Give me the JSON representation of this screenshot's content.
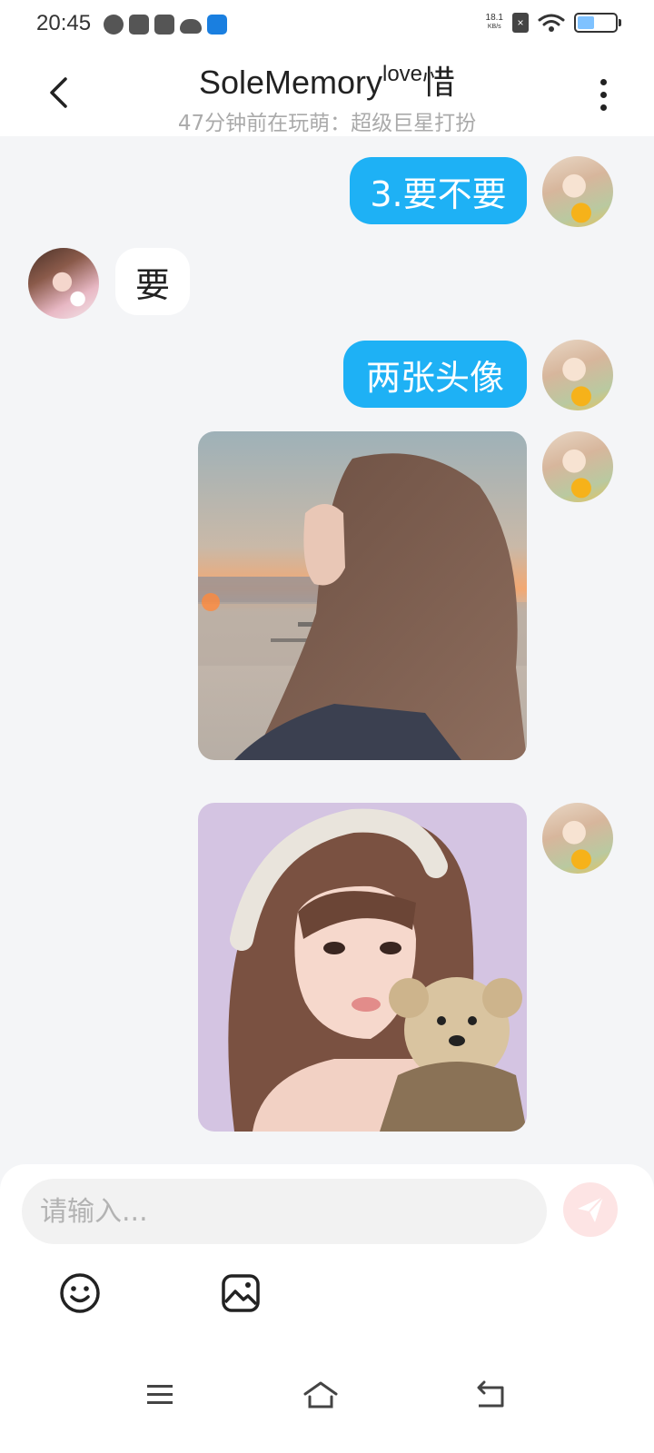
{
  "status_bar": {
    "time": "20:45",
    "speed_value": "18.1",
    "speed_unit": "KB/s",
    "battery_level": 0.45,
    "icons": [
      "clock-icon",
      "calendar-icon",
      "mail-icon",
      "cloud-icon",
      "app-icon",
      "no-sim-icon",
      "wifi-icon",
      "battery-icon"
    ]
  },
  "header": {
    "title": "SoleMemory",
    "title_sup": "love",
    "title_tail": "惜",
    "subtitle": "47分钟前在玩萌：超级巨星打扮"
  },
  "messages": [
    {
      "from": "me",
      "type": "text",
      "text": "3.要不要"
    },
    {
      "from": "her",
      "type": "text",
      "text": "要"
    },
    {
      "from": "me",
      "type": "text",
      "text": "两张头像"
    },
    {
      "from": "me",
      "type": "image",
      "image": "photo-girl-seaside"
    },
    {
      "from": "me",
      "type": "image",
      "image": "illustration-girl-with-puppy"
    }
  ],
  "composer": {
    "placeholder": "请输入..."
  },
  "colors": {
    "accent": "#1eb1f5",
    "background": "#f4f5f7",
    "send_button": "#fde4e4"
  }
}
